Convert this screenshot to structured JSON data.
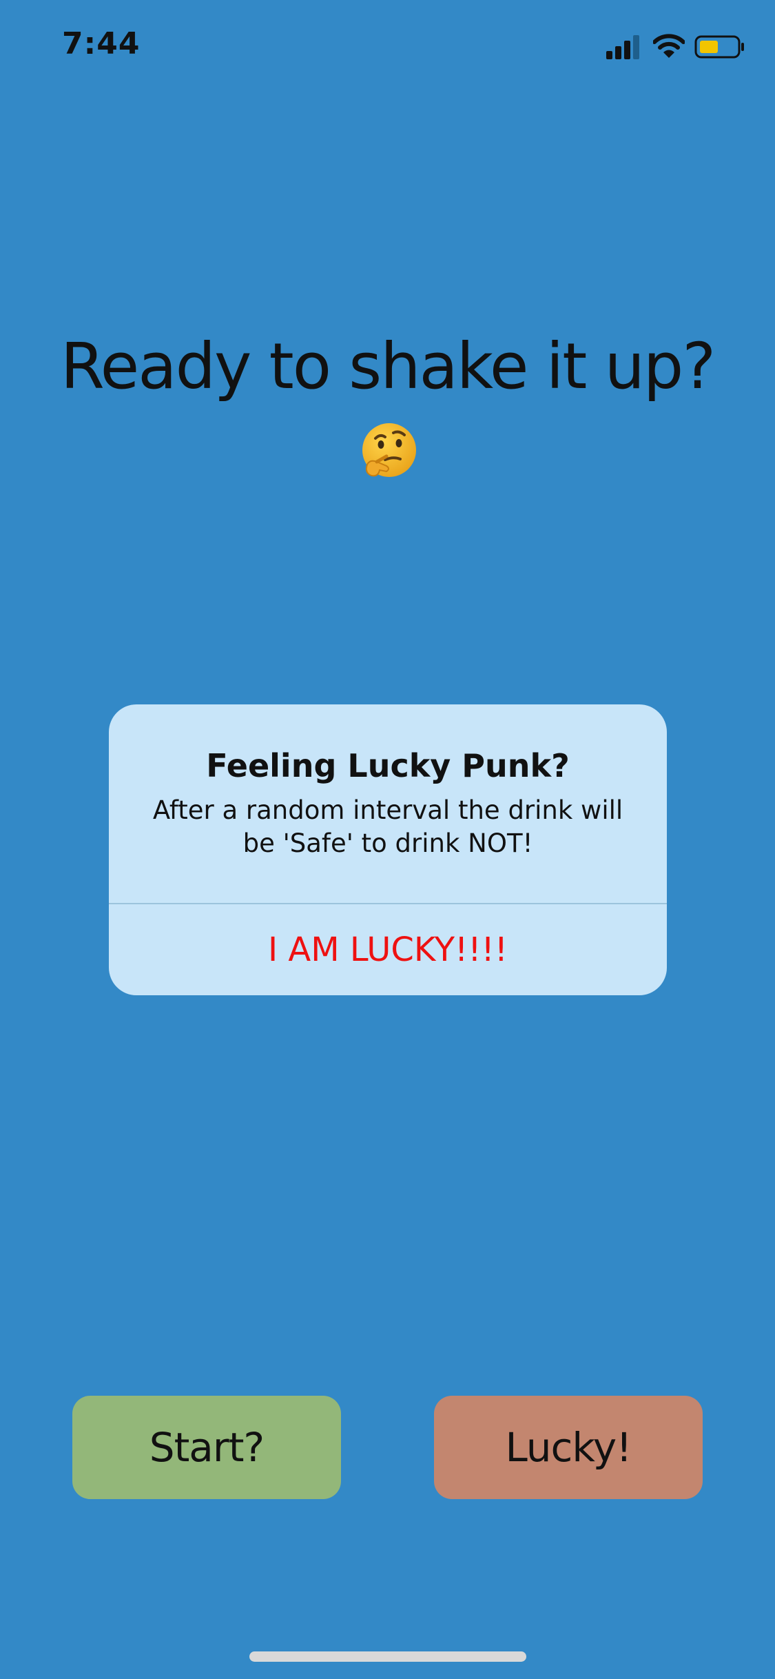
{
  "status_bar": {
    "time": "7:44",
    "icons": [
      "cellular-signal-icon",
      "wifi-icon",
      "battery-icon"
    ],
    "battery_color": "#f2c500"
  },
  "main": {
    "heading": "Ready to shake it up?",
    "heading_icon": "thinking-face-icon"
  },
  "alert": {
    "title": "Feeling Lucky Punk?",
    "message": "After a random interval the drink will be 'Safe' to drink NOT!",
    "action_label": "I AM LUCKY!!!!",
    "action_color": "#ee1111",
    "background": "#c8e5f9"
  },
  "buttons": {
    "start_label": "Start?",
    "start_color": "#93b779",
    "lucky_label": "Lucky!",
    "lucky_color": "#c3866f"
  },
  "theme": {
    "background": "#3389c7"
  }
}
